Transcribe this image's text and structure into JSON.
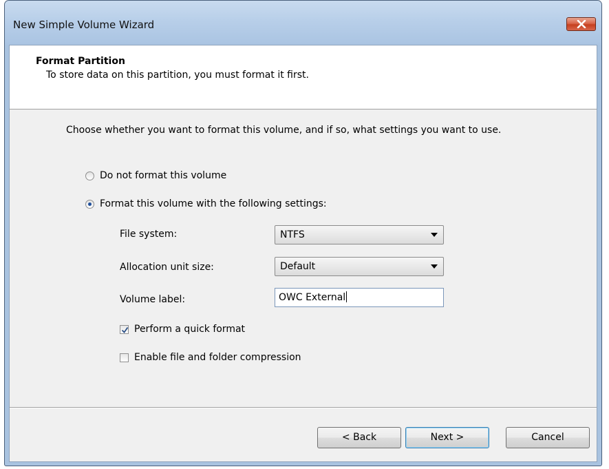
{
  "window": {
    "title": "New Simple Volume Wizard"
  },
  "header": {
    "title": "Format Partition",
    "subtitle": "To store data on this partition, you must format it first."
  },
  "intro": "Choose whether you want to format this volume, and if so, what settings you want to use.",
  "options": {
    "no_format": {
      "label": "Do not format this volume",
      "checked": false
    },
    "format": {
      "label": "Format this volume with the following settings:",
      "checked": true
    }
  },
  "settings": {
    "file_system": {
      "label": "File system:",
      "value": "NTFS"
    },
    "allocation_unit": {
      "label": "Allocation unit size:",
      "value": "Default"
    },
    "volume_label": {
      "label": "Volume label:",
      "value": "OWC External"
    }
  },
  "checkboxes": {
    "quick_format": {
      "label": "Perform a quick format",
      "checked": true
    },
    "compression": {
      "label": "Enable file and folder compression",
      "checked": false
    }
  },
  "buttons": {
    "back": "< Back",
    "next": "Next >",
    "cancel": "Cancel"
  }
}
